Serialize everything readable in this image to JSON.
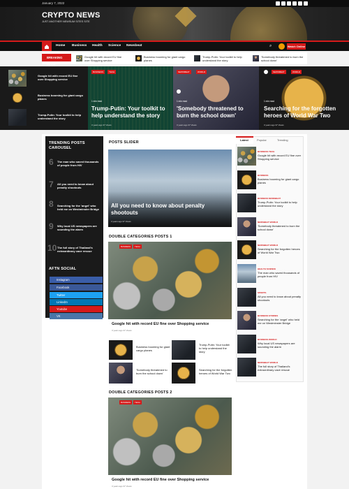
{
  "topbar": {
    "date": "January 7, 2022"
  },
  "header": {
    "site_title": "CRYPTO NEWS",
    "tagline": "JUST ANOTHER NEWSUM SITES SITE"
  },
  "nav": {
    "items": [
      "Home",
      "Business",
      "Health",
      "Science",
      "Newsbeat"
    ],
    "watch_label": "Watch Online"
  },
  "ticker": {
    "label": "BREAKING NEWS",
    "items": [
      "Google hit with record EU fine over Shopping service",
      "Business booming for giant cargo planes",
      "Trump-Putin: Your toolkit to help understand the story",
      "'Somebody threatened to burn the school down'"
    ]
  },
  "hero": {
    "list": [
      "Google hit with record EU fine over Shopping service",
      "Business booming for giant cargo planes",
      "Trump-Putin: Your toolkit to help understand the story"
    ],
    "cards": [
      {
        "badges": [
          "BUSINESS",
          "TECH"
        ],
        "read": "1 min read",
        "title": "Trump-Putin: Your toolkit to help understand the story",
        "meta": "3 years ago   37 Views"
      },
      {
        "badges": [
          "NEWSBEAT",
          "WORLD"
        ],
        "read": "1 min read",
        "title": "'Somebody threatened to burn the school down'",
        "meta": "3 years ago   37 Views"
      },
      {
        "badges": [
          "NEWSBEAT",
          "WORLD"
        ],
        "read": "1 min read",
        "title": "Searching for the forgotten heroes of World War Two",
        "meta": "3 years ago   37 Views"
      }
    ]
  },
  "trending": {
    "heading": "TRENDING POSTS CAROUSEL",
    "items": [
      {
        "num": "6",
        "title": "The man who saved thousands of people from HIV"
      },
      {
        "num": "7",
        "title": "All you need to know about penalty shootouts"
      },
      {
        "num": "8",
        "title": "Searching for the 'angel' who held me on Westminster Bridge"
      },
      {
        "num": "9",
        "title": "Why local US newspapers are sounding the alarm"
      },
      {
        "num": "10",
        "title": "The full story of Thailand's extraordinary cave rescue"
      }
    ]
  },
  "social": {
    "heading": "AFTN SOCIAL",
    "items": [
      "Instagram",
      "Facebook",
      "Twitter",
      "LinkedIn",
      "Youtube",
      "VK"
    ],
    "colors": [
      "#3a5da8",
      "#3b5998",
      "#1da1f2",
      "#0077b5",
      "#d51a1a",
      "#4a76a8"
    ]
  },
  "slider": {
    "heading": "POSTS SLIDER",
    "title": "All you need to know about penalty shootouts",
    "meta": "3 years ago   37 Views"
  },
  "double1": {
    "heading": "DOUBLE CATEGORIES POSTS 1",
    "badges": [
      "BUSINESS",
      "TECH"
    ],
    "title": "Google hit with record EU fine over Shopping service",
    "meta": "3 years ago   37 Views",
    "small": [
      "Business booming for giant cargo planes",
      "Trump-Putin: Your toolkit to help understand the story",
      "'Somebody threatened to burn the school down'",
      "Searching for the forgotten heroes of World War Two"
    ]
  },
  "double2": {
    "heading": "DOUBLE CATEGORIES POSTS 2",
    "badges": [
      "BUSINESS",
      "TECH"
    ],
    "title": "Google hit with record EU fine over Shopping service",
    "meta": "3 years ago   37 Views"
  },
  "tabs": {
    "labels": [
      "Latest",
      "Popular",
      "Trending"
    ],
    "items": [
      {
        "cat": "BUSINESS  TECH",
        "title": "Google hit with record EU fine over Shopping service"
      },
      {
        "cat": "BUSINESS",
        "title": "Business booming for giant cargo planes"
      },
      {
        "cat": "BUSINESS  NEWSBEAT",
        "title": "Trump-Putin: Your toolkit to help understand the story"
      },
      {
        "cat": "NEWSBEAT  WORLD",
        "title": "'Somebody threatened to burn the school down'"
      },
      {
        "cat": "NEWSBEAT  WORLD",
        "title": "Searching for the forgotten heroes of World War Two"
      },
      {
        "cat": "HEALTH  SCIENCE",
        "title": "The man who saved thousands of people from HIV"
      },
      {
        "cat": "SPORTS",
        "title": "All you need to know about penalty shootouts"
      },
      {
        "cat": "BUSINESS  STORIES",
        "title": "Searching for the 'angel' who held me on Westminster Bridge"
      },
      {
        "cat": "BUSINESS  WORLD",
        "title": "Why local US newspapers are sounding the alarm"
      },
      {
        "cat": "NEWSBEAT  WORLD",
        "title": "The full story of Thailand's extraordinary cave rescue"
      }
    ]
  }
}
